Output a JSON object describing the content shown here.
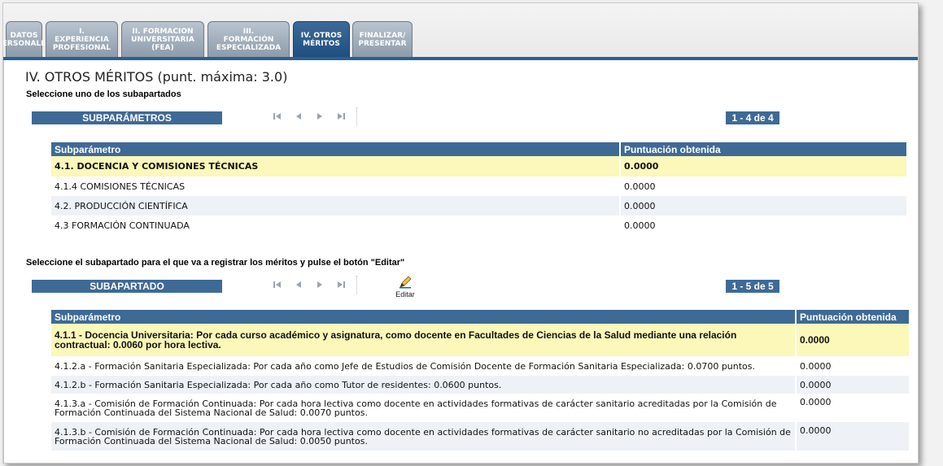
{
  "tabs": [
    {
      "label": "DATOS\nPERSONALES",
      "active": false
    },
    {
      "label": "I.\nEXPERIENCIA\nPROFESIONAL",
      "active": false
    },
    {
      "label": "II. FORMACION\nUNIVERSITARIA\n(FEA)",
      "active": false
    },
    {
      "label": "III.\nFORMACIÓN\nESPECIALIZADA",
      "active": false
    },
    {
      "label": "IV. OTROS\nMÉRITOS",
      "active": true
    },
    {
      "label": "FINALIZAR/\nPRESENTAR",
      "active": false
    }
  ],
  "page_title": "IV. OTROS MÉRITOS (punt. máxima: 3.0)",
  "section1": {
    "instruction": "Seleccione uno de los subapartados",
    "bar_label": "SUBPARÁMETROS",
    "counter": "1 - 4 de 4",
    "columns": [
      "Subparámetro",
      "Puntuación obtenida"
    ],
    "rows": [
      {
        "name": "4.1. DOCENCIA Y COMISIONES TÉCNICAS",
        "score": "0.0000",
        "selected": true
      },
      {
        "name": "4.1.4 COMISIONES TÉCNICAS",
        "score": "0.0000"
      },
      {
        "name": "4.2. PRODUCCIÓN CIENTÍFICA",
        "score": "0.0000"
      },
      {
        "name": "4.3 FORMACIÓN CONTINUADA",
        "score": "0.0000"
      }
    ]
  },
  "section2": {
    "instruction": "Seleccione el subapartado para el que va a registrar los méritos y pulse el botón \"Editar\"",
    "bar_label": "SUBAPARTADO",
    "counter": "1 - 5 de 5",
    "edit_label": "Editar",
    "columns": [
      "Subparámetro",
      "Puntuación obtenida"
    ],
    "rows": [
      {
        "name": "4.1.1 - Docencia Universitaria: Por cada curso académico y asignatura, como docente en Facultades de Ciencias de la Salud mediante una relación contractual: 0.0060 por hora lectiva.",
        "score": "0.0000",
        "selected": true
      },
      {
        "name": "4.1.2.a - Formación Sanitaria Especializada: Por cada año como Jefe de Estudios de Comisión Docente de Formación Sanitaria Especializada: 0.0700 puntos.",
        "score": "0.0000"
      },
      {
        "name": "4.1.2.b - Formación Sanitaria Especializada: Por cada año como Tutor de residentes: 0.0600 puntos.",
        "score": "0.0000"
      },
      {
        "name": "4.1.3.a - Comisión de Formación Continuada: Por cada hora lectiva como docente en actividades formativas de carácter sanitario acreditadas por la Comisión de Formación Continuada del Sistema Nacional de Salud: 0.0070 puntos.",
        "score": "0.0000"
      },
      {
        "name": "4.1.3.b - Comisión de Formación Continuada: Por cada hora lectiva como docente en actividades formativas de carácter sanitario no acreditadas por la Comisión de Formación Continuada del Sistema Nacional de Salud: 0.0050 puntos.",
        "score": "0.0000"
      }
    ]
  },
  "nav_icons": [
    "first-page-icon",
    "prev-page-icon",
    "next-page-icon",
    "last-page-icon"
  ],
  "colors": {
    "header_blue": "#3e6a96",
    "selected_row": "#fbf8ba",
    "alt_row": "#eef2f7"
  }
}
